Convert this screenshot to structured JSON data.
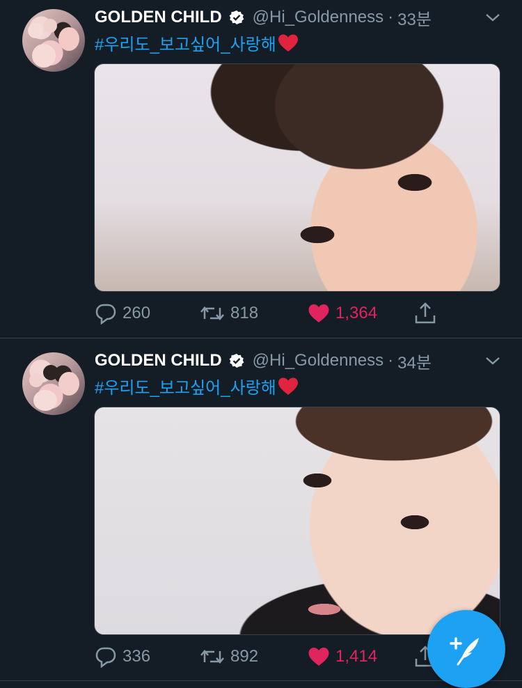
{
  "tweets": [
    {
      "name": "GOLDEN CHILD",
      "handle": "@Hi_Goldenness",
      "separator": "·",
      "time": "33분",
      "text": "#우리도_보고싶어_사랑해",
      "emoji": "heart-emoji",
      "media_alt": "photo",
      "replies": "260",
      "retweets": "818",
      "likes": "1,364"
    },
    {
      "name": "GOLDEN CHILD",
      "handle": "@Hi_Goldenness",
      "separator": "·",
      "time": "34분",
      "text": "#우리도_보고싶어_사랑해",
      "emoji": "heart-emoji",
      "media_alt": "photo",
      "replies": "336",
      "retweets": "892",
      "likes": "1,414"
    }
  ],
  "icons": {
    "verified": "verified-badge-icon",
    "more": "chevron-down-icon",
    "reply": "reply-icon",
    "retweet": "retweet-icon",
    "like": "heart-icon",
    "share": "share-icon",
    "compose": "compose-tweet-icon"
  },
  "colors": {
    "background": "#141d26",
    "link": "#1da1f2",
    "secondary_text": "#8899a6",
    "like_active": "#e0245e",
    "divider": "#38444d",
    "fab": "#1da1f2"
  }
}
